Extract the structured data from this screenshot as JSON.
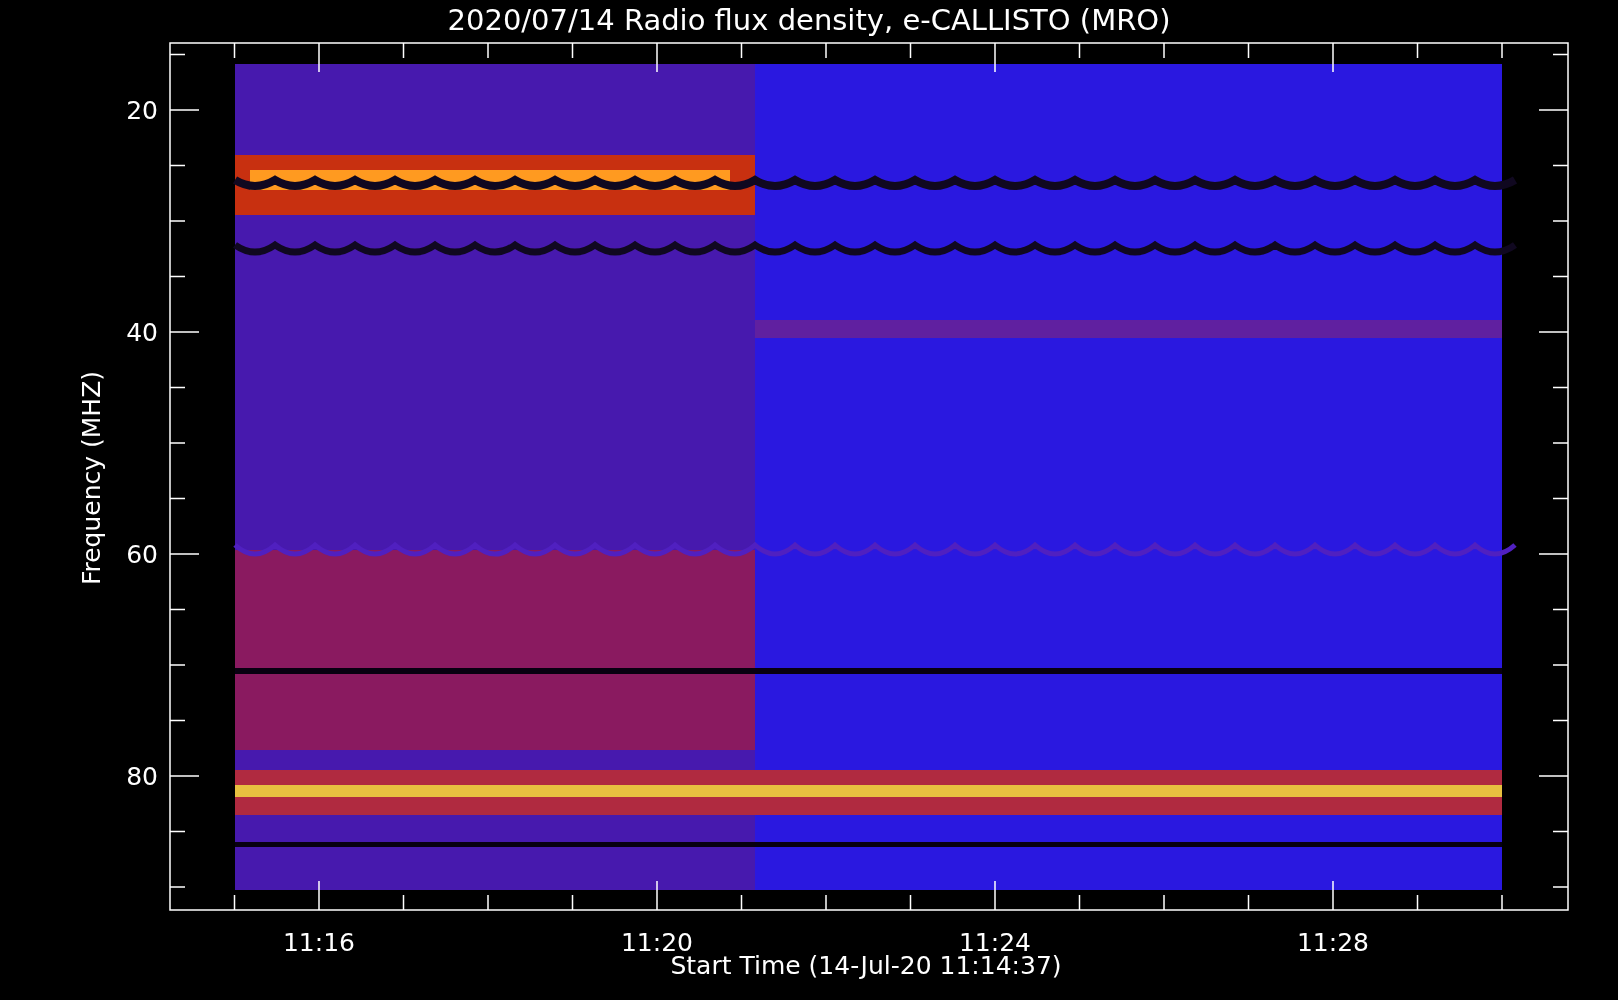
{
  "title": "2020/07/14  Radio flux density, e-CALLISTO (MRO)",
  "y_axis": {
    "label": "Frequency (MHZ)",
    "ticks": [
      "20",
      "40",
      "60",
      "80"
    ]
  },
  "x_axis": {
    "label": "Start Time (14-Jul-20 11:14:37)",
    "ticks": [
      "11:16",
      "11:20",
      "11:24",
      "11:28"
    ]
  }
}
